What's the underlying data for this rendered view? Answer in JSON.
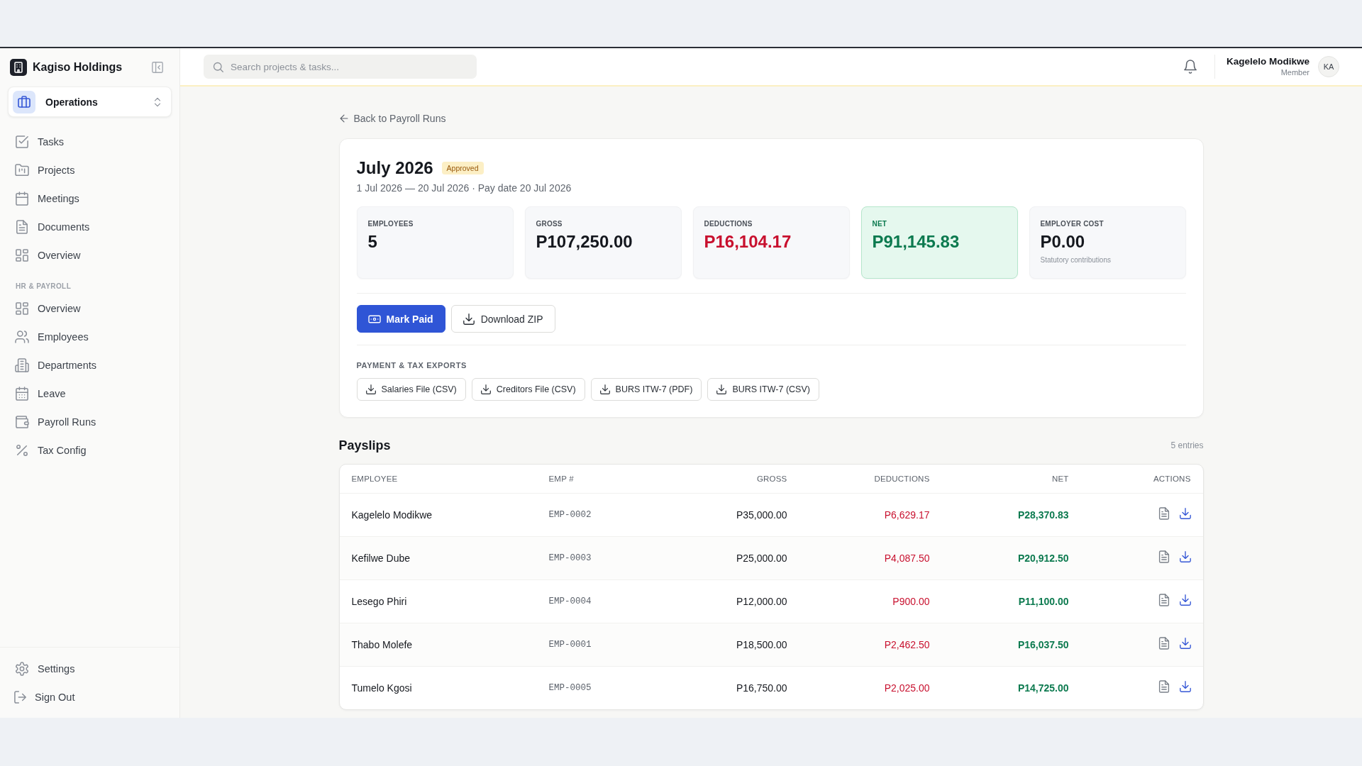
{
  "sidebar": {
    "brand": {
      "name": "Kagiso Holdings"
    },
    "workspace": {
      "name": "Operations"
    },
    "nav_items": [
      {
        "label": "Tasks",
        "selected": false
      },
      {
        "label": "Projects",
        "selected": false
      },
      {
        "label": "Meetings",
        "selected": false
      },
      {
        "label": "Documents",
        "selected": false
      },
      {
        "label": "Overview",
        "selected": false
      }
    ],
    "sections": [
      {
        "heading": "HR & PAYROLL",
        "items": [
          {
            "label": "Overview",
            "selected": false
          },
          {
            "label": "Employees",
            "selected": false
          },
          {
            "label": "Departments",
            "selected": false
          },
          {
            "label": "Leave",
            "selected": false
          },
          {
            "label": "Payroll Runs",
            "selected": false
          },
          {
            "label": "Tax Config",
            "selected": false
          }
        ]
      }
    ],
    "footer_items": [
      {
        "label": "Settings"
      },
      {
        "label": "Sign Out"
      }
    ]
  },
  "header": {
    "search": {
      "placeholder": "Search projects & tasks..."
    },
    "user": {
      "name": "Kagelelo Modikwe",
      "role": "Member",
      "initials": "KA"
    }
  },
  "back_link": "Back to Payroll Runs",
  "run": {
    "title": "July 2026",
    "status": "Approved",
    "period": "1 Jul 2026 — 20 Jul 2026 · Pay date 20 Jul 2026",
    "stats": [
      {
        "label": "EMPLOYEES",
        "value": "5",
        "kind": "plain"
      },
      {
        "label": "GROSS",
        "value": "P107,250.00",
        "kind": "plain"
      },
      {
        "label": "DEDUCTIONS",
        "value": "P16,104.17",
        "kind": "negative"
      },
      {
        "label": "NET",
        "value": "P91,145.83",
        "kind": "positive"
      },
      {
        "label": "EMPLOYER COST",
        "value": "P0.00",
        "kind": "plain",
        "note": "Statutory contributions"
      }
    ],
    "actions": [
      {
        "label": "Mark Paid",
        "kind": "primary"
      },
      {
        "label": "Download ZIP",
        "kind": "secondary"
      }
    ],
    "exports": {
      "heading": "PAYMENT & TAX EXPORTS",
      "buttons": [
        "Salaries File (CSV)",
        "Creditors File (CSV)",
        "BURS ITW-7 (PDF)",
        "BURS ITW-7 (CSV)"
      ]
    }
  },
  "payslips": {
    "title": "Payslips",
    "count": "5 entries",
    "table": {
      "columns": [
        "EMPLOYEE",
        "EMP #",
        "GROSS",
        "DEDUCTIONS",
        "NET",
        "ACTIONS"
      ],
      "rows": [
        {
          "employee": "Kagelelo Modikwe",
          "emp_no": "EMP-0002",
          "gross": "P35,000.00",
          "deductions": "P6,629.17",
          "net": "P28,370.83"
        },
        {
          "employee": "Kefilwe Dube",
          "emp_no": "EMP-0003",
          "gross": "P25,000.00",
          "deductions": "P4,087.50",
          "net": "P20,912.50"
        },
        {
          "employee": "Lesego Phiri",
          "emp_no": "EMP-0004",
          "gross": "P12,000.00",
          "deductions": "P900.00",
          "net": "P11,100.00"
        },
        {
          "employee": "Thabo Molefe",
          "emp_no": "EMP-0001",
          "gross": "P18,500.00",
          "deductions": "P2,462.50",
          "net": "P16,037.50"
        },
        {
          "employee": "Tumelo Kgosi",
          "emp_no": "EMP-0005",
          "gross": "P16,750.00",
          "deductions": "P2,025.00",
          "net": "P14,725.00"
        }
      ]
    }
  }
}
